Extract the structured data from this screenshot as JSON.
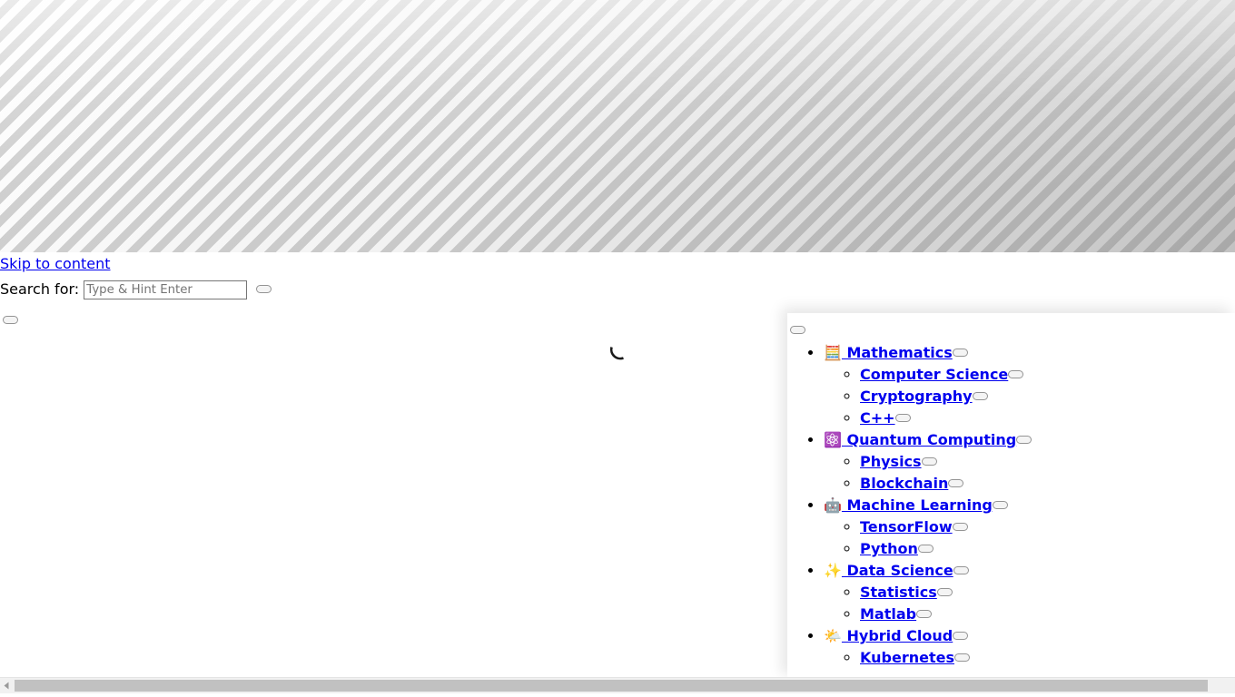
{
  "banner": {
    "name": "decorative-striped-banner",
    "stripe_color": "#d2d2d2",
    "base_color": "#ffffff"
  },
  "accessibility": {
    "skip_link": "Skip to content"
  },
  "search": {
    "label": "Search for:",
    "placeholder": "Type & Hint Enter",
    "value": "",
    "submit_label": ""
  },
  "loading": {
    "spinner_label": "",
    "spinner_color": "#1a1a1a"
  },
  "menu": {
    "toggle_label": "",
    "link_color": "#0000ee",
    "items": [
      {
        "label": "Mathematics",
        "icon": "abacus-icon",
        "glyph": "🧮",
        "toggle_label": "",
        "children": [
          {
            "label": "Computer Science",
            "toggle_label": ""
          },
          {
            "label": "Cryptography",
            "toggle_label": ""
          },
          {
            "label": "C++",
            "toggle_label": ""
          }
        ]
      },
      {
        "label": "Quantum Computing",
        "icon": "atom-icon",
        "glyph": "⚛️",
        "toggle_label": "",
        "children": [
          {
            "label": "Physics",
            "toggle_label": ""
          },
          {
            "label": "Blockchain",
            "toggle_label": ""
          }
        ]
      },
      {
        "label": "Machine Learning",
        "icon": "robot-icon",
        "glyph": "🤖",
        "toggle_label": "",
        "children": [
          {
            "label": "TensorFlow",
            "toggle_label": ""
          },
          {
            "label": "Python",
            "toggle_label": ""
          }
        ]
      },
      {
        "label": "Data Science",
        "icon": "sparkles-icon",
        "glyph": "✨",
        "toggle_label": "",
        "children": [
          {
            "label": "Statistics",
            "toggle_label": ""
          },
          {
            "label": "Matlab",
            "toggle_label": ""
          }
        ]
      },
      {
        "label": "Hybrid Cloud",
        "icon": "sun-behind-cloud-icon",
        "glyph": "🌤️",
        "toggle_label": "",
        "children": [
          {
            "label": "Kubernetes",
            "toggle_label": ""
          }
        ]
      }
    ]
  },
  "scrollbar": {
    "left_arrow": "◂",
    "thumb_color": "#c1c1c1",
    "track_color": "#f1f1f1"
  }
}
